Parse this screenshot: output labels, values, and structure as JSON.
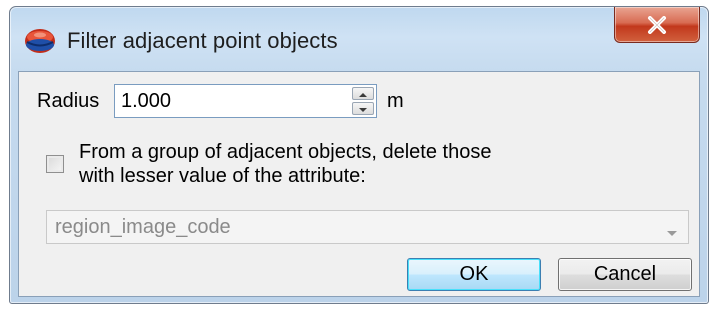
{
  "window": {
    "title": "Filter adjacent point objects",
    "close_label": "close"
  },
  "radius": {
    "label": "Radius",
    "value": "1.000",
    "unit": "m"
  },
  "delete_option": {
    "checked": false,
    "label_line1": "From a group of adjacent objects, delete those",
    "label_line2": "with lesser value of the attribute:"
  },
  "attribute_select": {
    "value": "region_image_code",
    "enabled": false
  },
  "buttons": {
    "ok": "OK",
    "cancel": "Cancel"
  },
  "icons": {
    "app": "app-logo-icon",
    "close": "close-icon",
    "spin_up": "arrow-up-icon",
    "spin_down": "arrow-down-icon",
    "dropdown": "chevron-down-icon"
  },
  "colors": {
    "accent": "#3c7fb1",
    "close_button": "#c2381c",
    "disabled_text": "#8a8a8a"
  }
}
